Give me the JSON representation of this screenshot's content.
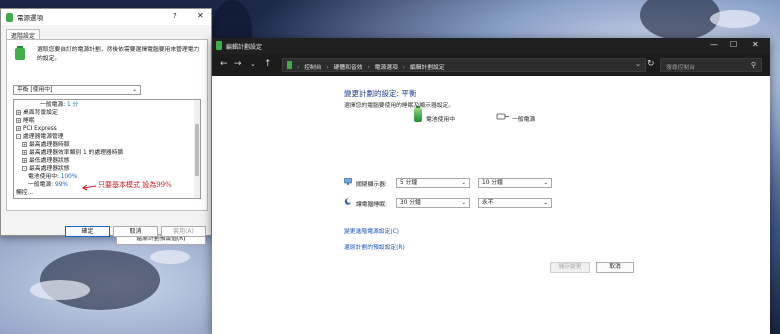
{
  "dialog": {
    "title": "電源選項",
    "help_btn": "?",
    "close_btn": "✕",
    "tab": "進階設定",
    "description": "選取您要自訂的電源計劃，然後依需要選擇電腦要用來管理電力的設定。",
    "plan_select": "平衡 [使用中]",
    "tree_rows": [
      {
        "indent": 4,
        "expander": "",
        "label": "一般電源:",
        "value": "1 分"
      },
      {
        "indent": 0,
        "expander": "+",
        "label": "桌面背景設定",
        "value": ""
      },
      {
        "indent": 0,
        "expander": "+",
        "label": "睡眠",
        "value": ""
      },
      {
        "indent": 0,
        "expander": "+",
        "label": "PCI Express",
        "value": ""
      },
      {
        "indent": 0,
        "expander": "-",
        "label": "處理器電源管理",
        "value": ""
      },
      {
        "indent": 1,
        "expander": "+",
        "label": "最高處理器時脈",
        "value": ""
      },
      {
        "indent": 1,
        "expander": "+",
        "label": "最高處理器效率類別 1 的處理器時脈",
        "value": ""
      },
      {
        "indent": 1,
        "expander": "+",
        "label": "最低處理器狀態",
        "value": ""
      },
      {
        "indent": 1,
        "expander": "-",
        "label": "最高處理器狀態",
        "value": ""
      },
      {
        "indent": 2,
        "expander": "",
        "label": "電池使用中:",
        "value": "100%"
      },
      {
        "indent": 2,
        "expander": "",
        "label": "一般電源:",
        "value": "99%"
      },
      {
        "indent": 0,
        "expander": "",
        "label": "觸控...",
        "value": ""
      }
    ],
    "annotation": "只要基本模式 設為99%",
    "restore_btn": "還原計劃預設值(R)",
    "ok_btn": "確定",
    "cancel_btn": "取消",
    "apply_btn": "套用(A)"
  },
  "window": {
    "title": "編輯計劃設定",
    "controls": {
      "minimize": "—",
      "maximize": "☐",
      "close": "✕"
    },
    "nav": {
      "back": "←",
      "forward": "→",
      "recent": "⌄",
      "up": "↑",
      "refresh": "↻"
    },
    "breadcrumbs": [
      "控制台",
      "硬體和音效",
      "電源選項",
      "編輯計劃設定"
    ],
    "search_placeholder": "搜尋控制台",
    "heading": "變更計劃的設定: 平衡",
    "subheading": "選擇您的電腦要使用的睡眠及顯示器設定。",
    "col_battery": "電池使用中",
    "col_plugged": "一般電源",
    "rows": [
      {
        "label": "關閉顯示器:",
        "battery": "5 分鐘",
        "plugged": "10 分鐘"
      },
      {
        "label": "讓電腦睡眠:",
        "battery": "30 分鐘",
        "plugged": "永不"
      }
    ],
    "link_advanced": "變更進階電源設定(C)",
    "link_restore": "還原計劃的預設設定(R)",
    "save_btn": "儲存變更",
    "cancel_btn": "取消"
  },
  "colors": {
    "heading": "#1d3d8f",
    "link": "#1a56b5",
    "annotation": "#d0181c",
    "value": "#1a64c8",
    "battery_green": "#3fae49"
  }
}
